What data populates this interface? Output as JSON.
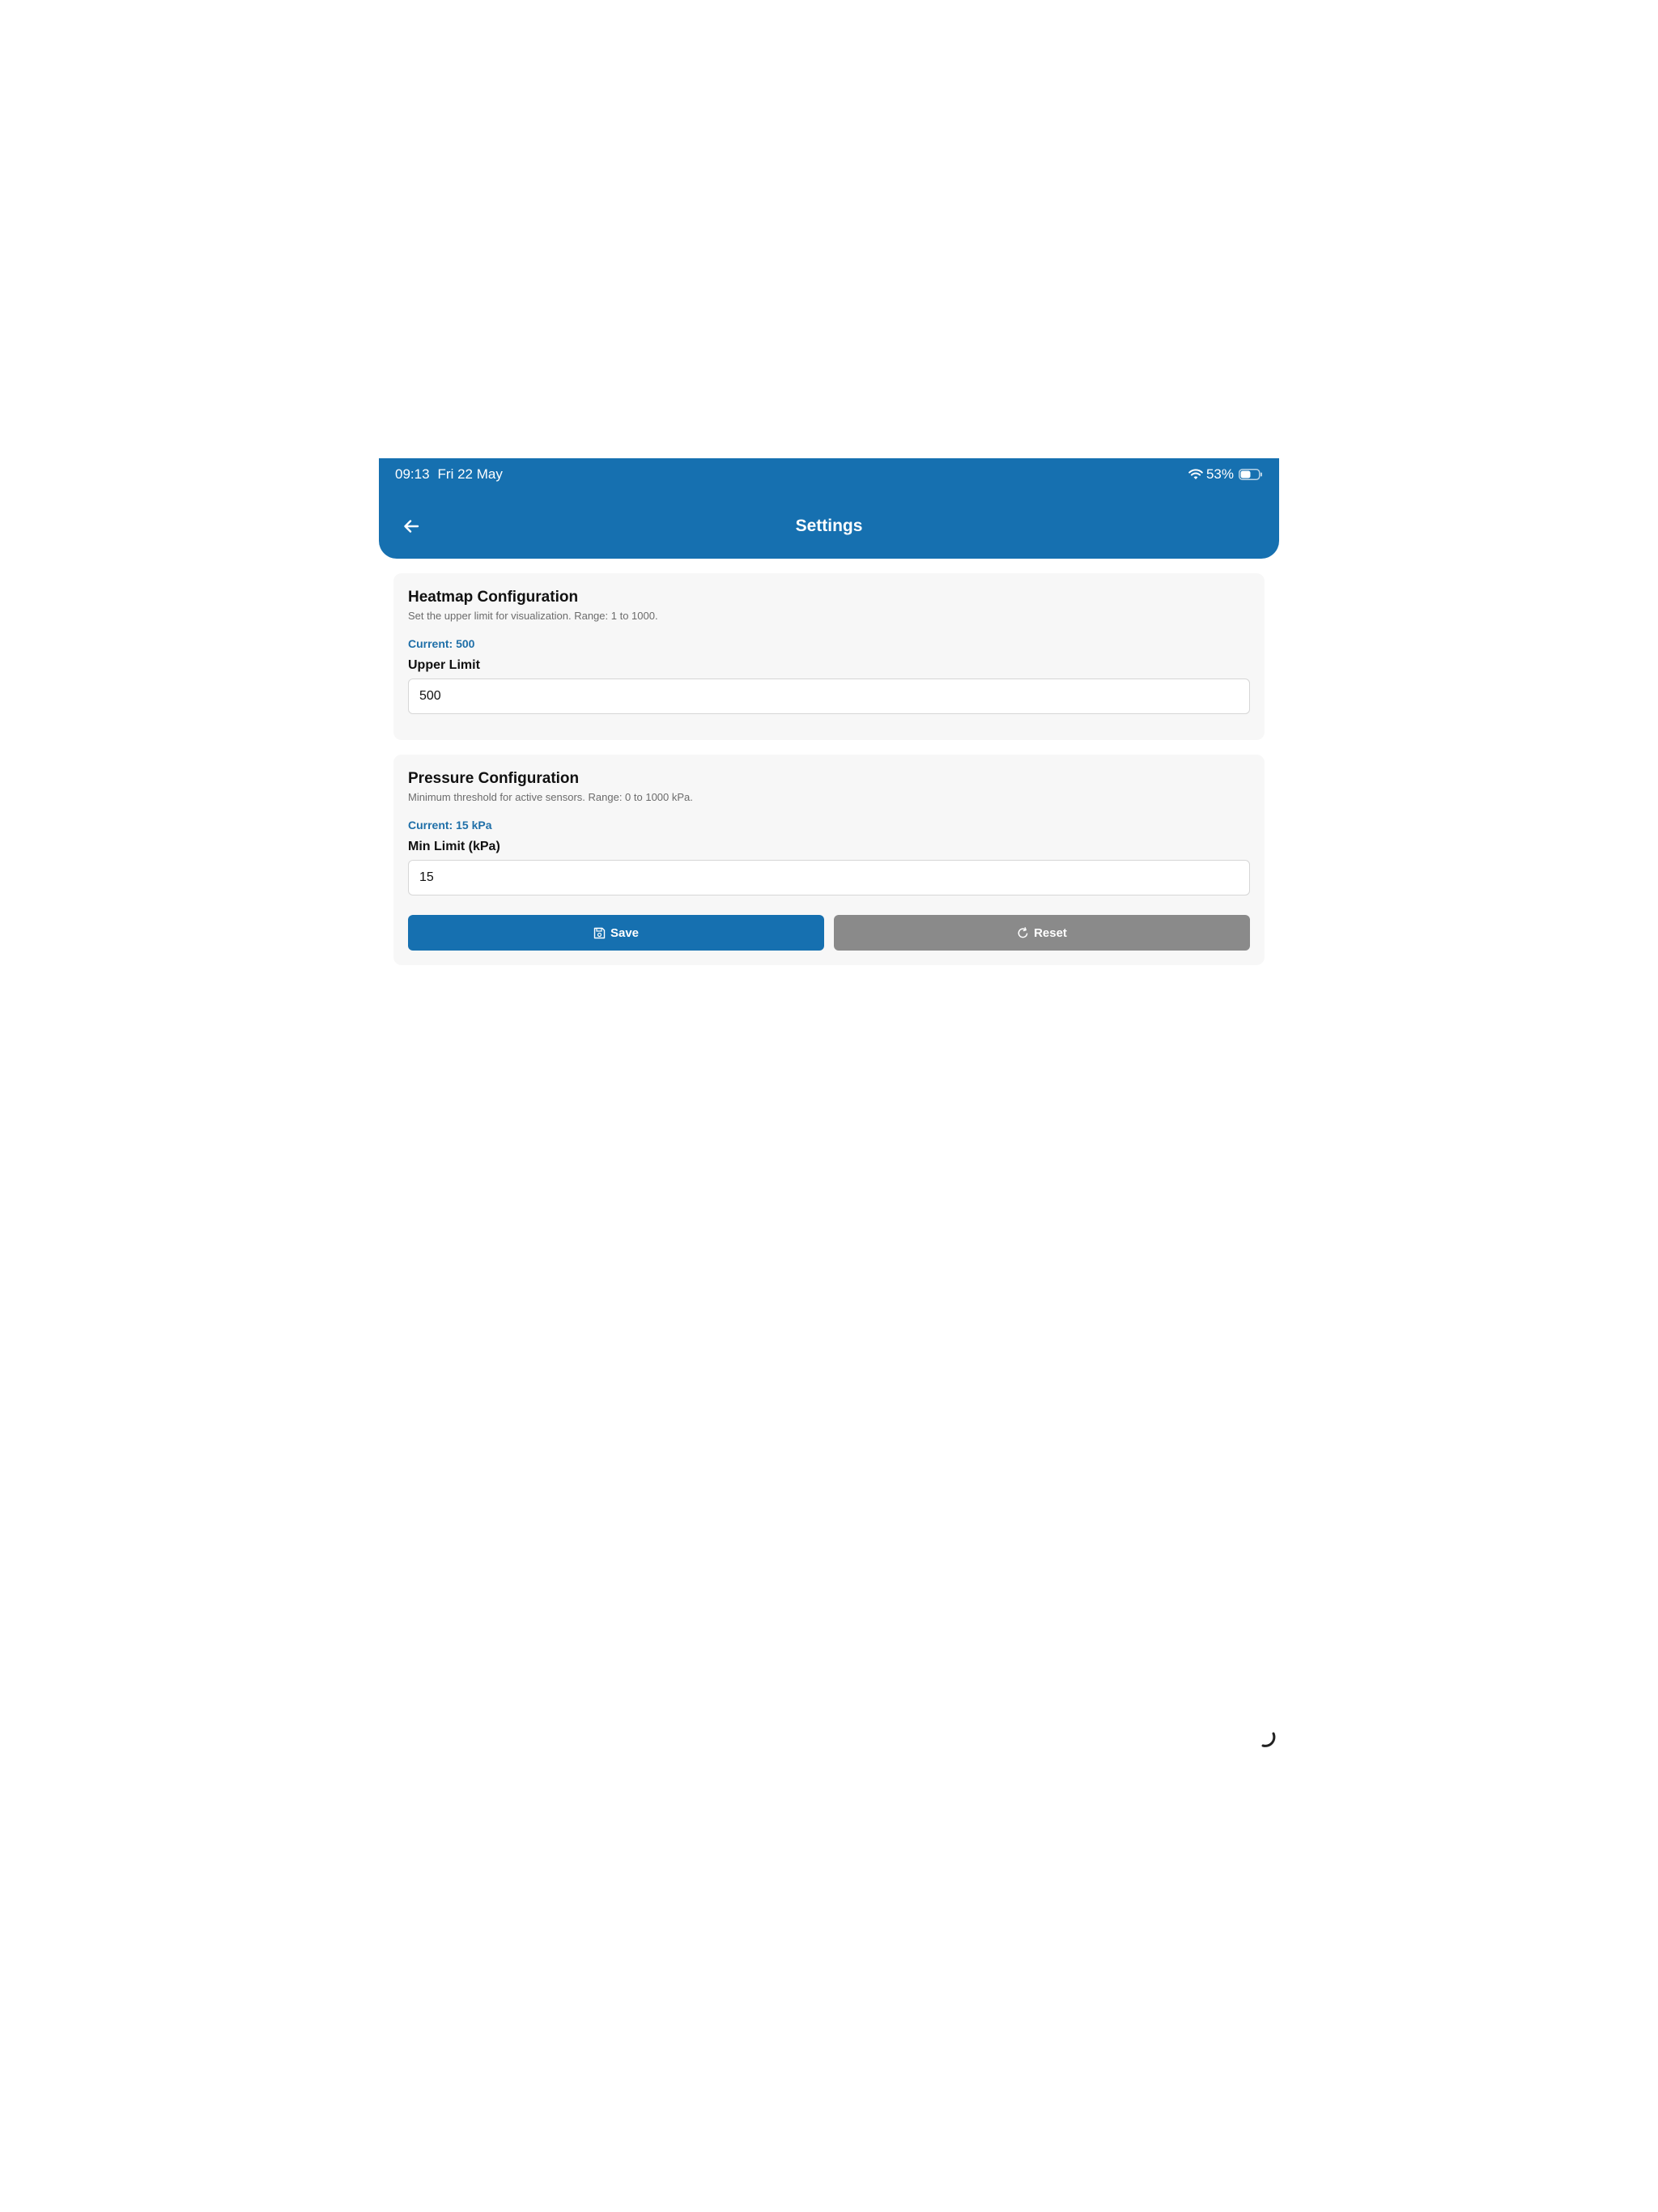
{
  "status_bar": {
    "time": "09:13",
    "date": "Fri 22 May",
    "battery": "53%",
    "wifi_icon": "wifi-icon",
    "battery_icon": "battery-icon"
  },
  "header": {
    "title": "Settings",
    "back_icon": "arrow-left-icon",
    "background_color": "#1670b0"
  },
  "heatmap": {
    "title": "Heatmap Configuration",
    "description": "Set the upper limit for visualization. Range: 1 to 1000.",
    "current": "Current: 500",
    "field_label": "Upper Limit",
    "value": "500"
  },
  "pressure": {
    "title": "Pressure Configuration",
    "description": "Minimum threshold for active sensors. Range: 0 to 1000 kPa.",
    "current": "Current: 15 kPa",
    "field_label": "Min Limit (kPa)",
    "value": "15"
  },
  "actions": {
    "save_label": "Save",
    "save_icon": "save-icon",
    "reset_label": "Reset",
    "reset_icon": "refresh-icon",
    "save_color": "#1670b0",
    "reset_color": "#8a8a8a"
  },
  "colors": {
    "accent": "#1670b0",
    "current_text": "#1f6fa8",
    "card_background": "#f7f7f7"
  }
}
